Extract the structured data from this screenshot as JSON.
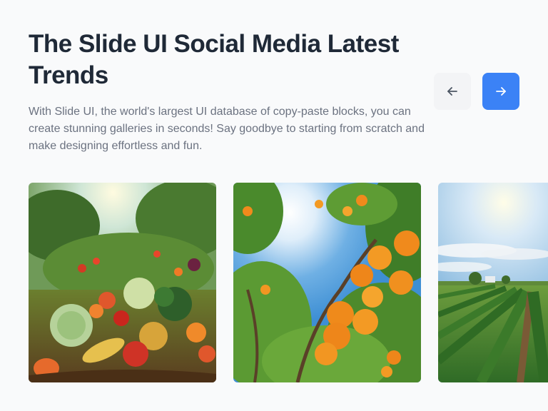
{
  "header": {
    "title": "The Slide UI Social Media Latest Trends",
    "description": "With Slide UI, the world's largest UI database of copy-paste blocks, you can create stunning galleries in seconds! Say goodbye to starting from scratch and make designing effortless and fun."
  },
  "navigation": {
    "prev_icon": "arrow-left-icon",
    "next_icon": "arrow-right-icon"
  },
  "gallery": {
    "slides": [
      {
        "subject": "vegetable-garden-harvest"
      },
      {
        "subject": "orange-tree-sunlight"
      },
      {
        "subject": "farm-field-rows"
      }
    ]
  },
  "colors": {
    "heading": "#1f2937",
    "body_text": "#6b7280",
    "accent": "#3b82f6",
    "secondary_button": "#f3f4f6",
    "background": "#f9fafb"
  }
}
